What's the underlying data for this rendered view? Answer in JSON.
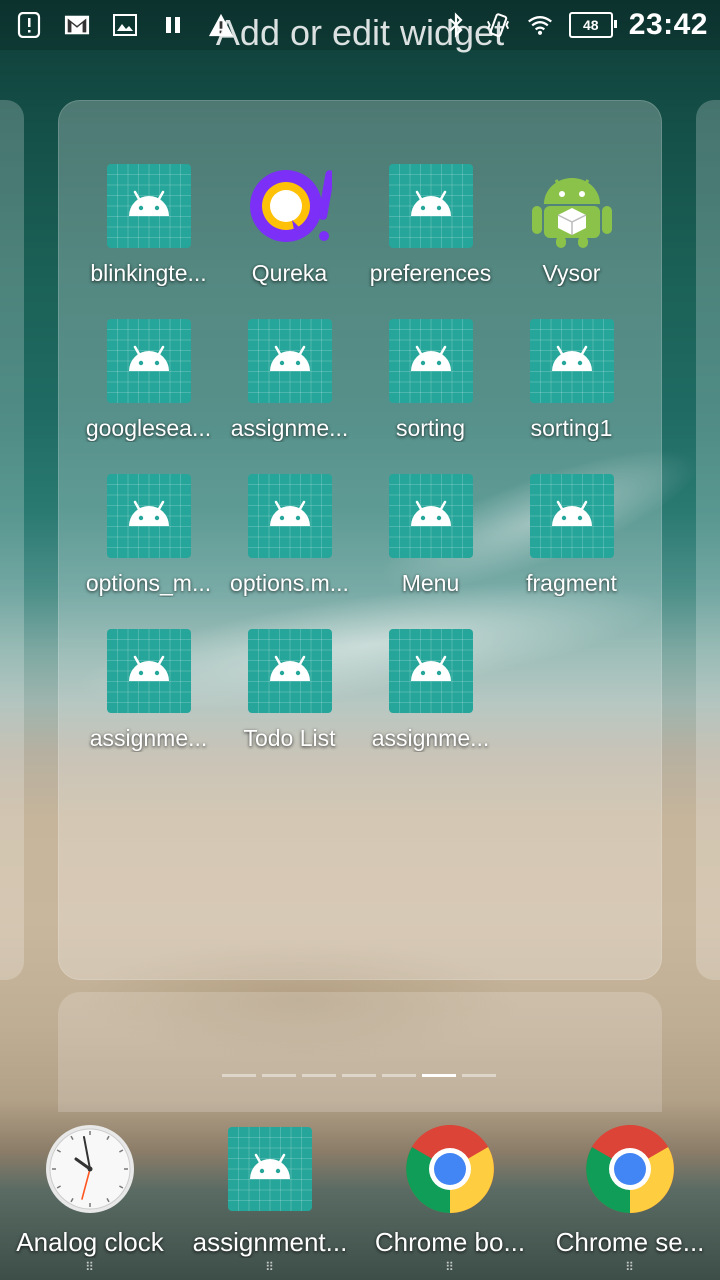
{
  "status_bar": {
    "time": "23:42",
    "battery": "48",
    "left_icons": [
      "alert-icon",
      "gmail-icon",
      "image-icon",
      "pause-icon",
      "warning-icon"
    ],
    "right_icons": [
      "bluetooth-icon",
      "vibrate-icon",
      "wifi-icon",
      "battery-icon"
    ]
  },
  "header": {
    "title": "Add or edit widget"
  },
  "folder": {
    "apps": [
      {
        "label": "blinkingte...",
        "icon": "android-app-icon"
      },
      {
        "label": "Qureka",
        "icon": "qureka-icon"
      },
      {
        "label": "preferences",
        "icon": "android-app-icon"
      },
      {
        "label": "Vysor",
        "icon": "vysor-icon"
      },
      {
        "label": "googlesea...",
        "icon": "android-app-icon"
      },
      {
        "label": "assignme...",
        "icon": "android-app-icon"
      },
      {
        "label": "sorting",
        "icon": "android-app-icon"
      },
      {
        "label": "sorting1",
        "icon": "android-app-icon"
      },
      {
        "label": "options_m...",
        "icon": "android-app-icon"
      },
      {
        "label": "options.m...",
        "icon": "android-app-icon"
      },
      {
        "label": "Menu",
        "icon": "android-app-icon"
      },
      {
        "label": "fragment",
        "icon": "android-app-icon"
      },
      {
        "label": "assignme...",
        "icon": "android-app-icon"
      },
      {
        "label": "Todo List",
        "icon": "android-app-icon"
      },
      {
        "label": "assignme...",
        "icon": "android-app-icon"
      }
    ]
  },
  "page_indicator": {
    "count": 7,
    "active": 6
  },
  "dock": {
    "apps": [
      {
        "label": "Analog clock",
        "icon": "analog-clock-icon"
      },
      {
        "label": "assignment...",
        "icon": "android-app-icon"
      },
      {
        "label": "Chrome bo...",
        "icon": "chrome-icon"
      },
      {
        "label": "Chrome se...",
        "icon": "chrome-icon"
      }
    ]
  },
  "colors": {
    "android_tile": "#26a69a",
    "android_robot": "#ffffff",
    "qureka_purple": "#7b2ff7",
    "qureka_yellow": "#ffc107",
    "vysor_green": "#8bc34a"
  }
}
